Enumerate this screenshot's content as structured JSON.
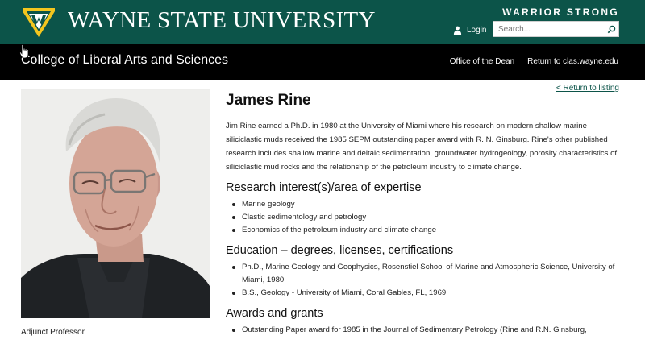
{
  "header": {
    "university_name": "WAYNE STATE UNIVERSITY",
    "tagline": "WARRIOR STRONG",
    "login_label": "Login",
    "search_placeholder": "Search...",
    "brand_colors": {
      "green": "#0c5449",
      "gold": "#f4c61e",
      "black": "#000000"
    }
  },
  "college_bar": {
    "title": "College of Liberal Arts and Sciences",
    "nav": [
      {
        "label": "Office of the Dean"
      },
      {
        "label": "Return to clas.wayne.edu"
      }
    ]
  },
  "profile": {
    "return_link": "< Return to listing",
    "name": "James Rine",
    "position": "Adjunct Professor",
    "bio": "Jim Rine earned a Ph.D. in 1980 at the University of Miami where his research on modern shallow marine siliciclastic muds received the 1985 SEPM outstanding paper award with R. N. Ginsburg. Rine's other published research includes shallow marine and deltaic sedimentation, groundwater hydrogeology, porosity characteristics of siliciclastic mud rocks and the relationship of the petroleum industry to climate change.",
    "sections": [
      {
        "heading": "Research interest(s)/area of expertise",
        "items": [
          "Marine geology",
          "Clastic sedimentology and petrology",
          "Economics of the petroleum industry and climate change"
        ]
      },
      {
        "heading": "Education – degrees, licenses, certifications",
        "items": [
          "Ph.D., Marine Geology and Geophysics, Rosenstiel School of Marine and Atmospheric Science, University of Miami, 1980",
          "B.S., Geology - University of Miami, Coral Gables, FL, 1969"
        ]
      },
      {
        "heading": "Awards and grants",
        "items": [
          "Outstanding Paper award for 1985 in the Journal of Sedimentary Petrology (Rine and R.N. Ginsburg,"
        ]
      }
    ]
  }
}
